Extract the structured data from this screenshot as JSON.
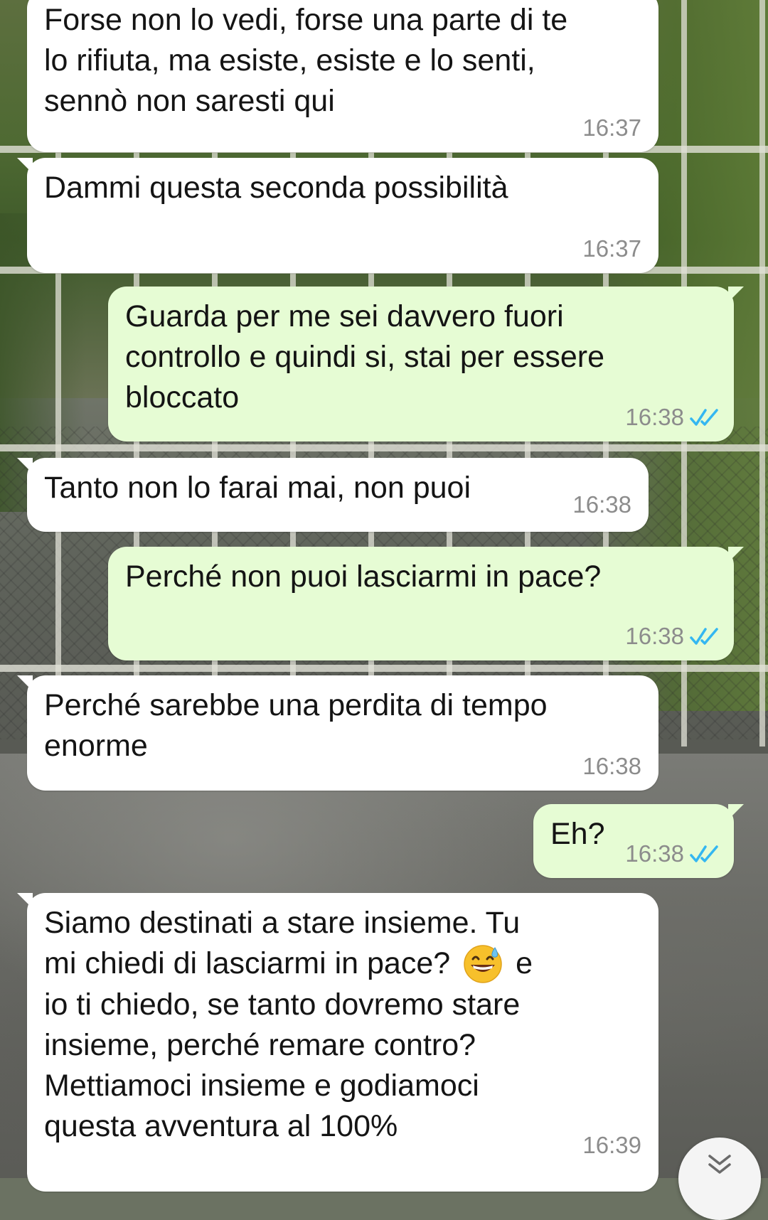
{
  "messages": [
    {
      "direction": "incoming",
      "text": "Forse non lo vedi, forse una parte di te\nlo rifiuta, ma esiste, esiste e lo senti,\nsennò non saresti qui",
      "time": "16:37"
    },
    {
      "direction": "incoming",
      "text": "Dammi questa seconda possibilità",
      "time": "16:37"
    },
    {
      "direction": "outgoing",
      "text": "Guarda per me sei davvero fuori\ncontrollo e quindi si, stai per essere\nbloccato",
      "time": "16:38",
      "status": "read"
    },
    {
      "direction": "incoming",
      "text": "Tanto non lo farai mai, non puoi",
      "time": "16:38"
    },
    {
      "direction": "outgoing",
      "text": "Perché non puoi lasciarmi in pace?",
      "time": "16:38",
      "status": "read"
    },
    {
      "direction": "incoming",
      "text": "Perché sarebbe una perdita di tempo\nenorme",
      "time": "16:38"
    },
    {
      "direction": "outgoing",
      "text": "Eh?",
      "time": "16:38",
      "status": "read"
    },
    {
      "direction": "incoming",
      "text_before_emoji": "Siamo destinati a stare insieme. Tu\nmi chiedi di lasciarmi in pace? ",
      "emoji": "grinning-face-with-sweat",
      "text_after_emoji": " e\nio ti chiedo, se tanto dovremo stare\ninsieme, perché remare contro?\nMettiamoci insieme e godiamoci\nquesta avventura al 100%",
      "time": "16:39"
    }
  ],
  "colors": {
    "incoming_bubble": "#ffffff",
    "outgoing_bubble": "#e6fcd4",
    "timestamp": "#8c8c8c",
    "read_ticks": "#34b7f1"
  },
  "icons": {
    "read_receipt": "double-check-icon",
    "scroll_down": "chevron-double-down-icon"
  }
}
